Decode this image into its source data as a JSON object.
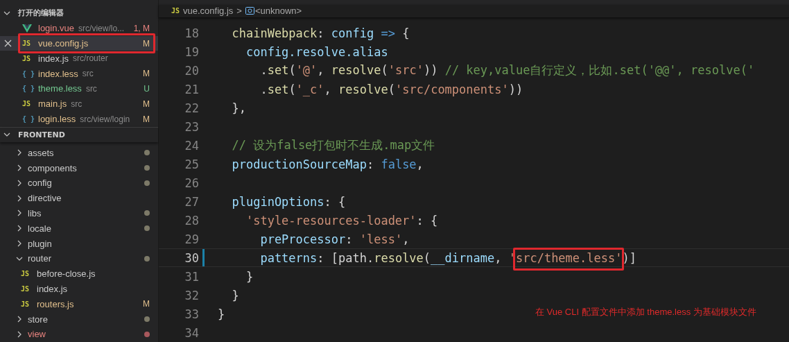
{
  "open_editors": {
    "title": "打开的编辑器",
    "expanded": true,
    "items": [
      {
        "kind": "vue",
        "name": "login.vue",
        "path": "src/view/lo...",
        "status": "1, M",
        "color": "#e8837f",
        "selected": false,
        "boxed": false
      },
      {
        "kind": "js",
        "badge": "JS",
        "name": "vue.config.js",
        "status": "M",
        "color": "#e2c08d",
        "selected": true,
        "boxed": true
      },
      {
        "kind": "js",
        "badge": "JS",
        "name": "index.js",
        "path": "src/router",
        "selected": false,
        "boxed": false
      },
      {
        "kind": "less",
        "badge": "{ }",
        "name": "index.less",
        "path": "src",
        "status": "M",
        "color": "#e2c08d",
        "selected": false,
        "boxed": false
      },
      {
        "kind": "less",
        "badge": "{ }",
        "name": "theme.less",
        "path": "src",
        "status": "U",
        "color": "#73c991",
        "selected": false,
        "boxed": false
      },
      {
        "kind": "js",
        "badge": "JS",
        "name": "main.js",
        "path": "src",
        "status": "M",
        "color": "#e2c08d",
        "selected": false,
        "boxed": false
      },
      {
        "kind": "less",
        "badge": "{ }",
        "name": "login.less",
        "path": "src/view/login",
        "status": "M",
        "color": "#e2c08d",
        "selected": false,
        "boxed": false
      }
    ]
  },
  "explorer": {
    "title": "FRONTEND",
    "expanded": true,
    "items": [
      {
        "kind": "folder",
        "name": "assets",
        "expanded": false,
        "color": "#7d7a68",
        "error": false
      },
      {
        "kind": "folder",
        "name": "components",
        "expanded": false,
        "color": "#7d7a68",
        "error": false
      },
      {
        "kind": "folder",
        "name": "config",
        "expanded": false,
        "color": "#7d7a68",
        "error": false
      },
      {
        "kind": "folder",
        "name": "directive",
        "expanded": false,
        "error": false
      },
      {
        "kind": "folder",
        "name": "libs",
        "expanded": false,
        "color": "#7d7a68",
        "error": false
      },
      {
        "kind": "folder",
        "name": "locale",
        "expanded": false,
        "color": "#7d7a68",
        "error": false
      },
      {
        "kind": "folder",
        "name": "plugin",
        "expanded": false,
        "error": false
      },
      {
        "kind": "folder",
        "name": "router",
        "expanded": true,
        "color": "#7d7a68",
        "error": false,
        "children": [
          {
            "kind": "file",
            "badge": "JS",
            "name": "before-close.js"
          },
          {
            "kind": "file",
            "badge": "JS",
            "name": "index.js"
          },
          {
            "kind": "file",
            "badge": "JS",
            "name": "routers.js",
            "status": "M",
            "color": "#e2c08d"
          }
        ]
      },
      {
        "kind": "folder",
        "name": "store",
        "expanded": false,
        "color": "#7d7a68",
        "error": false
      },
      {
        "kind": "folder",
        "name": "view",
        "expanded": false,
        "color": "#a8585c",
        "error": true
      }
    ]
  },
  "breadcrumb": {
    "badge": "JS",
    "file": "vue.config.js",
    "separator": ">",
    "symbol": "<unknown>"
  },
  "code_lines": [
    {
      "number": "18",
      "current": false,
      "modified": false,
      "tokens": [
        {
          "kind": "fn",
          "text": "  chainWebpack"
        },
        {
          "kind": "p",
          "text": ": "
        },
        {
          "kind": "prop",
          "text": "config"
        },
        {
          "kind": "kw",
          "text": " => "
        },
        {
          "kind": "p",
          "text": "{"
        }
      ]
    },
    {
      "number": "19",
      "current": false,
      "modified": false,
      "tokens": [
        {
          "kind": "prop",
          "text": "    config.resolve.alias"
        }
      ]
    },
    {
      "number": "20",
      "current": false,
      "modified": false,
      "tokens": [
        {
          "kind": "p",
          "text": "      ."
        },
        {
          "kind": "fn",
          "text": "set"
        },
        {
          "kind": "p",
          "text": "("
        },
        {
          "kind": "str",
          "text": "'@'"
        },
        {
          "kind": "p",
          "text": ", "
        },
        {
          "kind": "fn",
          "text": "resolve"
        },
        {
          "kind": "p",
          "text": "("
        },
        {
          "kind": "str",
          "text": "'src'"
        },
        {
          "kind": "p",
          "text": ")) "
        },
        {
          "kind": "cmt",
          "text": "// key,value自行定义，比如.set('@@', resolve('"
        }
      ]
    },
    {
      "number": "21",
      "current": false,
      "modified": false,
      "tokens": [
        {
          "kind": "p",
          "text": "      ."
        },
        {
          "kind": "fn",
          "text": "set"
        },
        {
          "kind": "p",
          "text": "("
        },
        {
          "kind": "str",
          "text": "'_c'"
        },
        {
          "kind": "p",
          "text": ", "
        },
        {
          "kind": "fn",
          "text": "resolve"
        },
        {
          "kind": "p",
          "text": "("
        },
        {
          "kind": "str",
          "text": "'src/components'"
        },
        {
          "kind": "p",
          "text": "))"
        }
      ]
    },
    {
      "number": "22",
      "current": false,
      "modified": false,
      "tokens": [
        {
          "kind": "p",
          "text": "  },"
        }
      ]
    },
    {
      "number": "23",
      "current": false,
      "modified": false
    },
    {
      "number": "24",
      "current": false,
      "modified": false,
      "tokens": [
        {
          "kind": "cmt",
          "text": "  // 设为false打包时不生成.map文件"
        }
      ]
    },
    {
      "number": "25",
      "current": false,
      "modified": false,
      "tokens": [
        {
          "kind": "prop",
          "text": "  productionSourceMap"
        },
        {
          "kind": "p",
          "text": ": "
        },
        {
          "kind": "kw",
          "text": "false"
        },
        {
          "kind": "p",
          "text": ","
        }
      ]
    },
    {
      "number": "26",
      "current": false,
      "modified": false
    },
    {
      "number": "27",
      "current": false,
      "modified": false,
      "tokens": [
        {
          "kind": "prop",
          "text": "  pluginOptions"
        },
        {
          "kind": "p",
          "text": ": {"
        }
      ]
    },
    {
      "number": "28",
      "current": false,
      "modified": false,
      "tokens": [
        {
          "kind": "str",
          "text": "    'style-resources-loader'"
        },
        {
          "kind": "p",
          "text": ": {"
        }
      ]
    },
    {
      "number": "29",
      "current": false,
      "modified": false,
      "tokens": [
        {
          "kind": "prop",
          "text": "      preProcessor"
        },
        {
          "kind": "p",
          "text": ": "
        },
        {
          "kind": "str",
          "text": "'less'"
        },
        {
          "kind": "p",
          "text": ","
        }
      ]
    },
    {
      "number": "30",
      "current": true,
      "modified": true,
      "tokens": [
        {
          "kind": "prop",
          "text": "      patterns"
        },
        {
          "kind": "p",
          "text": ": [path."
        },
        {
          "kind": "fn",
          "text": "resolve"
        },
        {
          "kind": "p",
          "text": "("
        },
        {
          "kind": "prop",
          "text": "__dirname"
        },
        {
          "kind": "p",
          "text": ", "
        },
        {
          "kind": "str",
          "text": "'"
        },
        {
          "kind": "str",
          "text": "src/theme.less'",
          "boxed": true
        },
        {
          "kind": "p",
          "text": ")]"
        }
      ]
    },
    {
      "number": "31",
      "current": false,
      "modified": false,
      "tokens": [
        {
          "kind": "p",
          "text": "    }"
        }
      ]
    },
    {
      "number": "32",
      "current": false,
      "modified": false,
      "tokens": [
        {
          "kind": "p",
          "text": "  }"
        }
      ]
    },
    {
      "number": "33",
      "current": false,
      "modified": false,
      "tokens": [
        {
          "kind": "p",
          "text": "}"
        }
      ]
    },
    {
      "number": "34",
      "current": false,
      "modified": false
    }
  ],
  "annotation": "在 Vue CLI 配置文件中添加 theme.less 为基础模块文件"
}
